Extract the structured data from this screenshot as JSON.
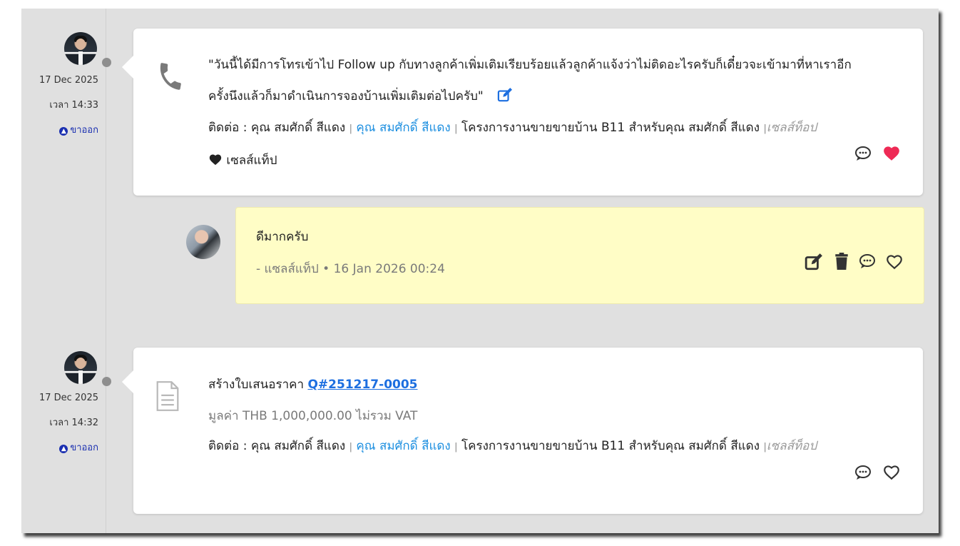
{
  "timeline": [
    {
      "date": "17 Dec 2025",
      "time": "เวลา 14:33",
      "direction": "ขาออก",
      "type_icon": "phone-icon",
      "message_line1": "\"วันนี้ได้มีการโทรเข้าไป Follow up กับทางลูกค้าเพิ่มเติมเรียบร้อยแล้วลูกค้าแจ้งว่าไม่ติดอะไรครับก็เดี๋ยวจะเข้ามาที่หาเราอีก",
      "message_line2": "ครั้งนึงแล้วก็มาดำเนินการจองบ้านเพิ่มเติมต่อไปครับ\"",
      "contact_label": "ติดต่อ : คุณ สมศักดิ์ สีแดง",
      "contact_link": "คุณ สมศักดิ์ สีแดง",
      "project": "โครงการงานขายขายบ้าน B11 สำหรับคุณ สมศักดิ์ สีแดง",
      "owner": "เซลส์ท็อป",
      "liked_by": "เซลส์แท็ป",
      "liked": true
    },
    {
      "date": "17 Dec 2025",
      "time": "เวลา 14:32",
      "direction": "ขาออก",
      "type_icon": "document-icon",
      "title_prefix": "สร้างใบเสนอราคา",
      "quote_no": "Q#251217-0005",
      "value_text": "มูลค่า THB 1,000,000.00 ไม่รวม VAT",
      "contact_label": "ติดต่อ : คุณ สมศักดิ์ สีแดง",
      "contact_link": "คุณ สมศักดิ์ สีแดง",
      "project": "โครงการงานขายขายบ้าน B11 สำหรับคุณ สมศักดิ์ สีแดง",
      "owner": "เซลส์ท็อป",
      "liked": false
    }
  ],
  "reply": {
    "text": "ดีมากครับ",
    "author_line": "- แซลส์แท็ป • 16 Jan 2026 00:24"
  },
  "separator": "|",
  "colors": {
    "panel_bg": "#e0e0e0",
    "reply_bg": "#fffdc6",
    "link_blue": "#1d8fe0",
    "heart_red": "#ee2a55",
    "exit_blue": "#1a2fb0"
  }
}
